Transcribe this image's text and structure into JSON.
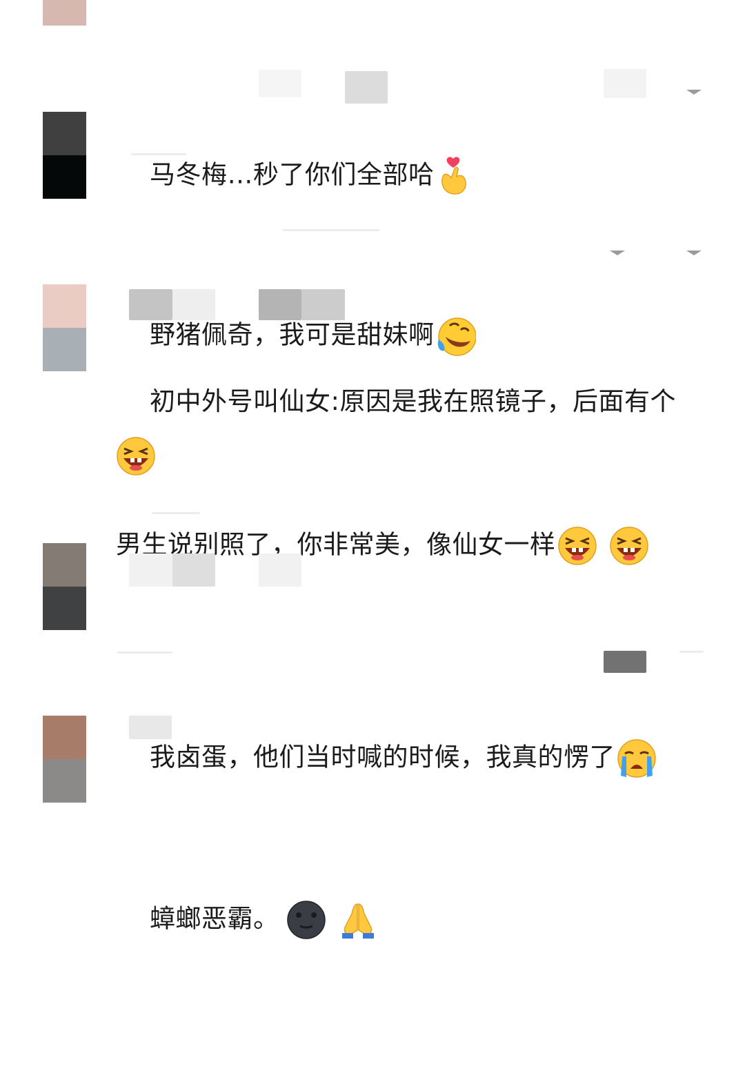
{
  "comments": [
    {
      "text": "马冬梅…秒了你们全部哈",
      "emoji": [
        "finger-heart-icon"
      ],
      "avatar_colors": [
        "#d6b8b0",
        "#d6b8b0"
      ]
    },
    {
      "text": "野猪佩奇，我可是甜妹啊",
      "emoji": [
        "rolling-on-floor-laughing-icon"
      ],
      "avatar_colors": [
        "#404040",
        "#050808"
      ]
    },
    {
      "text": "初中外号叫仙女:原因是我在照镜子，后面有个\n男生说别照了，你非常美，像仙女一样",
      "emoji": [
        "grinning-squint-icon",
        "grinning-squint-icon",
        "grinning-squint-icon"
      ],
      "avatar_colors": [
        "#ebccc4",
        "#a8b0b6"
      ]
    },
    {
      "text": "我卤蛋，他们当时喊的时候，我真的愣了",
      "emoji": [
        "loudly-crying-face-icon"
      ],
      "avatar_colors": [
        "#847b74",
        "#3f4142"
      ]
    },
    {
      "text": "蟑螂恶霸。",
      "emoji": [
        "new-moon-face-icon",
        "folded-hands-icon"
      ],
      "avatar_colors": [
        "#a77c68",
        "#8c8a88"
      ]
    }
  ],
  "colors": {
    "text": "#1b1b1b",
    "background": "#ffffff",
    "chevron": "#9a9a9a"
  }
}
